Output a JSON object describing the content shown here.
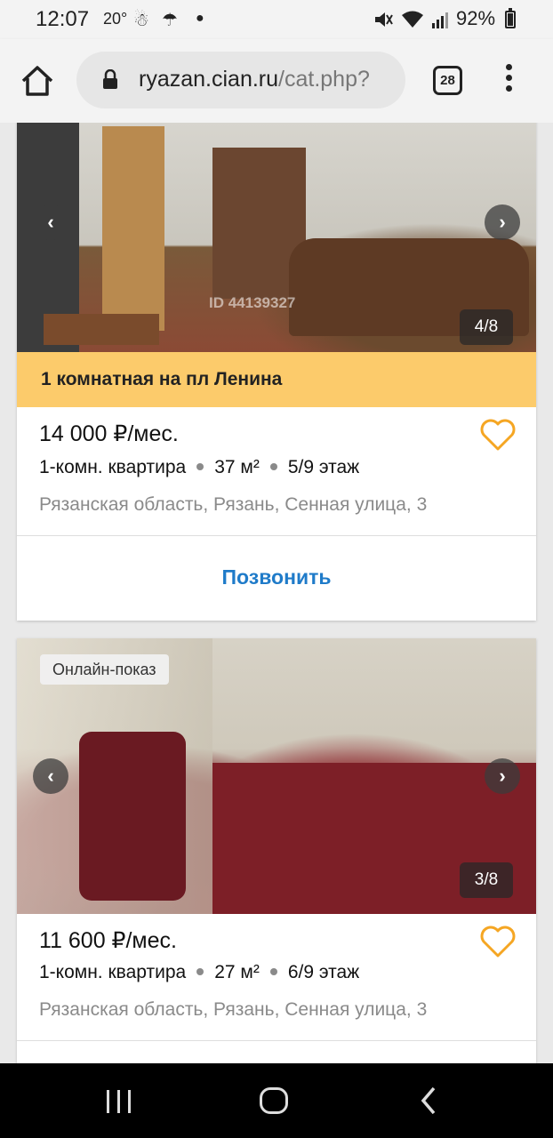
{
  "status": {
    "time": "12:07",
    "temperature": "20°",
    "battery": "92%",
    "icons": [
      "person-icon",
      "umbrella-icon",
      "dot-icon",
      "mute-icon",
      "wifi-icon",
      "signal-icon",
      "battery-icon"
    ]
  },
  "browser": {
    "url_host": "ryazan.cian.ru",
    "url_path": "/cat.php?",
    "tabs_count": "28"
  },
  "listings": [
    {
      "badge": "",
      "photo_counter": "4/8",
      "watermark_id": "ID 44139327",
      "title_banner": "1 комнатная на пл Ленина",
      "price": "14 000 ₽/мес.",
      "rooms": "1-комн. квартира",
      "area": "37 м²",
      "floor": "5/9 этаж",
      "address": "Рязанская область, Рязань, Сенная улица, 3",
      "call_label": "Позвонить"
    },
    {
      "badge": "Онлайн-показ",
      "photo_counter": "3/8",
      "price": "11 600 ₽/мес.",
      "rooms": "1-комн. квартира",
      "area": "27 м²",
      "floor": "6/9 этаж",
      "address": "Рязанская область, Рязань, Сенная улица, 3"
    }
  ],
  "colors": {
    "banner": "#fccb6b",
    "heart": "#f5a623",
    "call": "#1f7bc9"
  }
}
